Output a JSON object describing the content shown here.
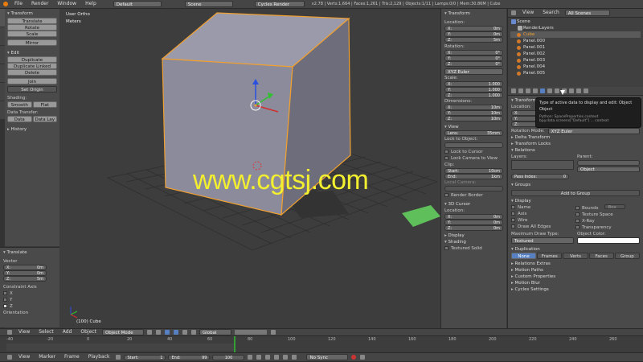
{
  "topbar": {
    "menus": [
      "File",
      "Render",
      "Window",
      "Help"
    ],
    "layout": "Default",
    "scene": "Scene",
    "engine": "Cycles Render",
    "stats": "v2.78 | Verts:1,664 | Faces:1,261 | Tris:2,129 | Objects:1/11 | Lamps:0/0 | Mem:30.86M | Cube"
  },
  "tool_shelf": {
    "tabs": [
      "Tools",
      "Create",
      "Relations",
      "Animation",
      "Physics",
      "Grease Pencil"
    ],
    "transform_header": "Transform",
    "transform_buttons": [
      "Translate",
      "Rotate",
      "Scale",
      "Mirror"
    ],
    "edit_header": "Edit",
    "edit_buttons": [
      "Duplicate",
      "Duplicate Linked",
      "Delete",
      "Join"
    ],
    "set_origin": "Set Origin",
    "shading_label": "Shading:",
    "shading_buttons": [
      "Smooth",
      "Flat"
    ],
    "data_transfer_label": "Data Transfer:",
    "data_transfer_buttons": [
      "Data",
      "Data Lay"
    ],
    "history_header": "History"
  },
  "operator_panel": {
    "header": "Translate",
    "vector_label": "Vector",
    "vector": [
      {
        "axis": "X:",
        "value": "0m"
      },
      {
        "axis": "Y:",
        "value": "0m"
      },
      {
        "axis": "Z:",
        "value": "5m"
      }
    ],
    "constraint_label": "Constraint Axis",
    "axes": [
      "X",
      "Y",
      "Z"
    ],
    "orientation_label": "Orientation"
  },
  "viewport": {
    "view_name": "User Ortho",
    "units": "Meters",
    "object_label": "(100) Cube",
    "watermark": "www.cgtsj.com"
  },
  "viewport_header": {
    "menus": [
      "View",
      "Select",
      "Add",
      "Object"
    ],
    "mode": "Object Mode",
    "orientation": "Global"
  },
  "properties_region": {
    "transform_header": "Transform",
    "location_label": "Location:",
    "location": [
      {
        "axis": "X:",
        "value": "0m"
      },
      {
        "axis": "Y:",
        "value": "0m"
      },
      {
        "axis": "Z:",
        "value": "5m"
      }
    ],
    "rotation_label": "Rotation:",
    "rotation": [
      {
        "axis": "X:",
        "value": "0°"
      },
      {
        "axis": "Y:",
        "value": "0°"
      },
      {
        "axis": "Z:",
        "value": "0°"
      }
    ],
    "rotation_mode": "XYZ Euler",
    "scale_label": "Scale:",
    "scale": [
      {
        "axis": "X:",
        "value": "1.000"
      },
      {
        "axis": "Y:",
        "value": "1.000"
      },
      {
        "axis": "Z:",
        "value": "1.000"
      }
    ],
    "dimensions_label": "Dimensions:",
    "dimensions": [
      {
        "axis": "X:",
        "value": "10m"
      },
      {
        "axis": "Y:",
        "value": "10m"
      },
      {
        "axis": "Z:",
        "value": "10m"
      }
    ],
    "view_header": "View",
    "lens_label": "Lens:",
    "lens_value": "35mm",
    "lock_object_label": "Lock to Object:",
    "lock_cursor": "Lock to Cursor",
    "lock_camera": "Lock Camera to View",
    "clip_label": "Clip:",
    "clip_start_label": "Start:",
    "clip_start": "10cm",
    "clip_end_label": "End:",
    "clip_end": "1km",
    "local_camera_label": "Local Camera:",
    "render_border": "Render Border",
    "cursor_header": "3D Cursor",
    "cursor_location_label": "Location:",
    "cursor": [
      {
        "axis": "X:",
        "value": "0m"
      },
      {
        "axis": "Y:",
        "value": "0m"
      },
      {
        "axis": "Z:",
        "value": "0m"
      }
    ],
    "display_header": "Display",
    "shading_header": "Shading",
    "textured_solid": "Textured Solid"
  },
  "outliner": {
    "menus": [
      "View",
      "Search"
    ],
    "filter": "All Scenes",
    "items": [
      "Scene",
      "RenderLayers",
      "Cube",
      "Panel.000",
      "Panel.001",
      "Panel.002",
      "Panel.003",
      "Panel.004",
      "Panel.005"
    ]
  },
  "tooltip": {
    "title": "Type of active data to display and edit:",
    "title_value": "Object",
    "subtitle": "Object",
    "python": "Python: SpaceProperties.context",
    "python2": "bpy.data.screens[\"Default\"] ... context"
  },
  "object_props": {
    "transform_header": "Transform",
    "location_label": "Location:",
    "loc": [
      {
        "axis": "X:",
        "value": "0m"
      },
      {
        "axis": "Y:",
        "value": "0m"
      },
      {
        "axis": "Z:",
        "value": "5m"
      }
    ],
    "rotation_mode_label": "Rotation Mode:",
    "rotation_mode": "XYZ Euler",
    "delta_header": "Delta Transform",
    "locks_header": "Transform Locks",
    "relations_header": "Relations",
    "layers_label": "Layers:",
    "parent_label": "Parent:",
    "parent_type": "Object",
    "pass_index_label": "Pass Index:",
    "pass_index": "0",
    "groups_header": "Groups",
    "add_to_group": "Add to Group",
    "display_header": "Display",
    "display_checks": [
      "Name",
      "Axis",
      "Wire",
      "Draw All Edges"
    ],
    "display_checks2": [
      "Bounds",
      "Texture Space",
      "X-Ray",
      "Transparency"
    ],
    "bounds_type": "Box",
    "max_draw_label": "Maximum Draw Type:",
    "max_draw": "Textured",
    "obj_color_label": "Object Color:",
    "duplication_header": "Duplication",
    "dup_tabs": [
      "None",
      "Frames",
      "Verts",
      "Faces",
      "Group"
    ],
    "closed_sections": [
      "Relations Extras",
      "Motion Paths",
      "Custom Properties",
      "Motion Blur",
      "Cycles Settings"
    ]
  },
  "timeline": {
    "ticks": [
      "-40",
      "-20",
      "0",
      "20",
      "40",
      "60",
      "80",
      "100",
      "120",
      "140",
      "160",
      "180",
      "200",
      "220",
      "240",
      "260"
    ],
    "menus": [
      "View",
      "Marker",
      "Frame",
      "Playback"
    ],
    "start_label": "Start:",
    "start": "1",
    "end_label": "End:",
    "end": "99",
    "current": "100",
    "sync": "No Sync"
  },
  "colors": {
    "accent": "#5680c2",
    "selected": "#f0a030",
    "watermark": "#f2ee30"
  }
}
